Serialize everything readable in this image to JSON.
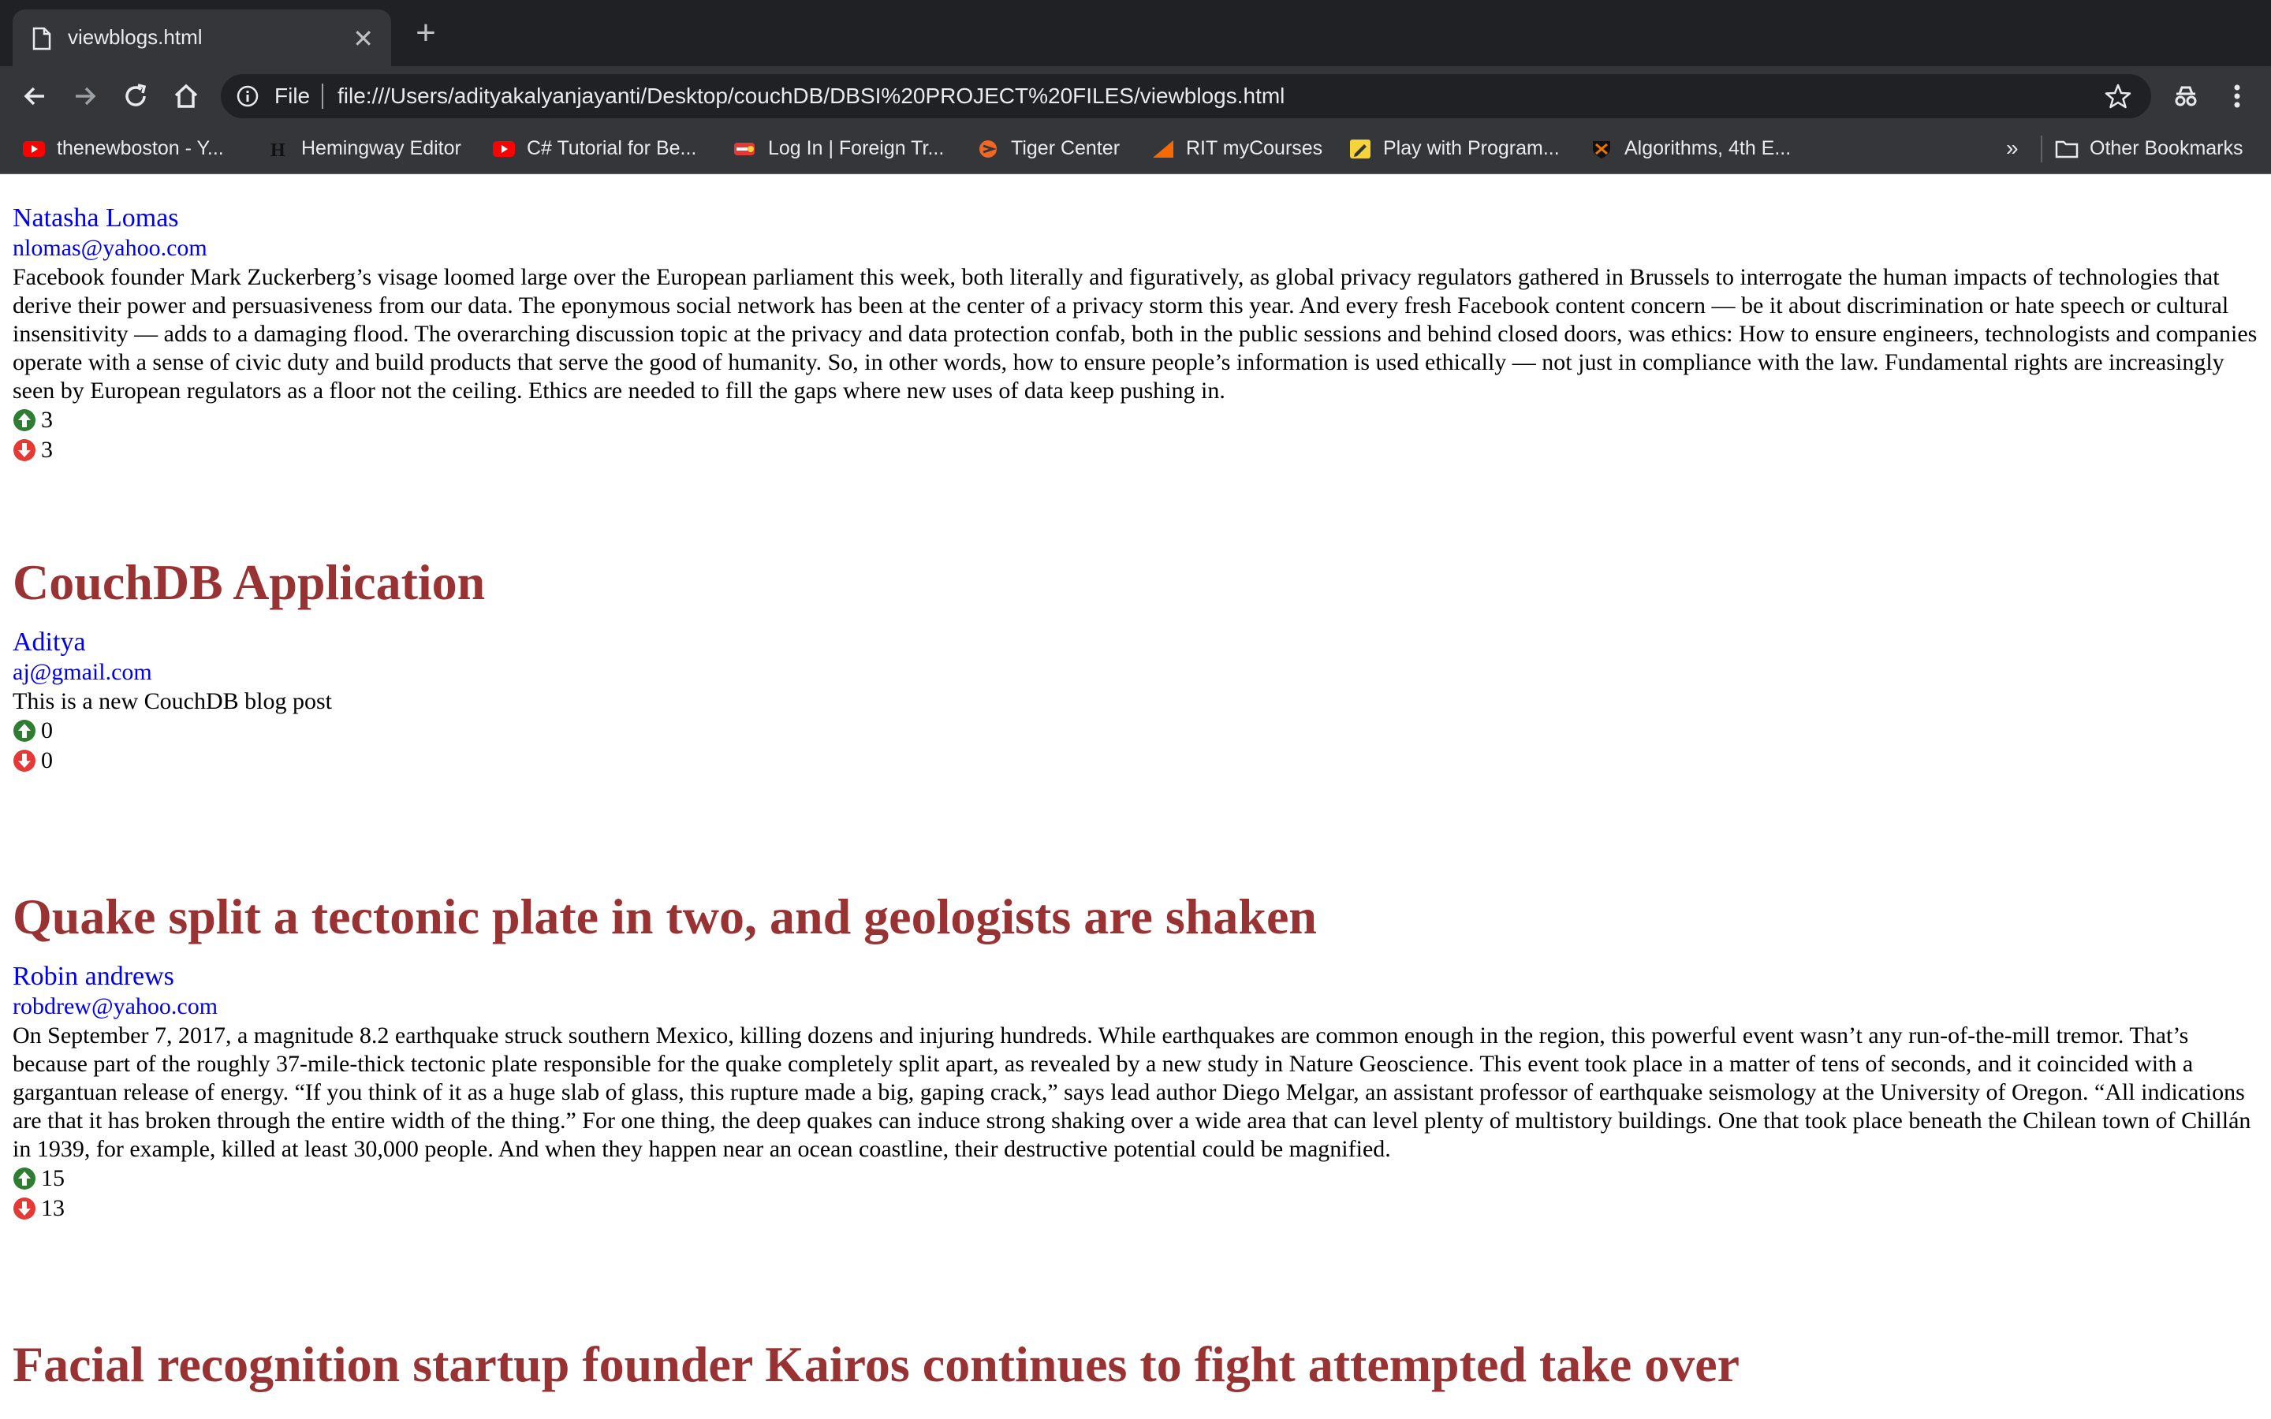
{
  "browser": {
    "tab_title": "viewblogs.html",
    "close_glyph": "✕",
    "new_tab_glyph": "+",
    "url_protocol": "File",
    "url": "file:///Users/adityakalyanjayanti/Desktop/couchDB/DBSI%20PROJECT%20FILES/viewblogs.html",
    "bookmarks": [
      {
        "label": "thenewboston - Y...",
        "icon": "youtube-icon",
        "color": "#ff0000"
      },
      {
        "label": "Hemingway Editor",
        "icon": "hemingway-h-icon",
        "color": "#000000"
      },
      {
        "label": "C# Tutorial for Be...",
        "icon": "youtube-icon",
        "color": "#ff0000"
      },
      {
        "label": "Log In | Foreign Tr...",
        "icon": "foreign-trade-icon",
        "color": "#e53935"
      },
      {
        "label": "Tiger Center",
        "icon": "tiger-center-icon",
        "color": "#f26722"
      },
      {
        "label": "RIT myCourses",
        "icon": "mycourses-icon",
        "color": "#f76902"
      },
      {
        "label": "Play with Program...",
        "icon": "pencil-icon",
        "color": "#f5d33b"
      },
      {
        "label": "Algorithms, 4th E...",
        "icon": "princeton-shield-icon",
        "color": "#e77500"
      }
    ],
    "overflow_glyph": "»",
    "other_bookmarks": "Other Bookmarks"
  },
  "posts": [
    {
      "title": "",
      "author": "Natasha Lomas",
      "email": "nlomas@yahoo.com",
      "body": "Facebook founder Mark Zuckerberg’s visage loomed large over the European parliament this week, both literally and figuratively, as global privacy regulators gathered in Brussels to interrogate the human impacts of technologies that derive their power and persuasiveness from our data. The eponymous social network has been at the center of a privacy storm this year. And every fresh Facebook content concern — be it about discrimination or hate speech or cultural insensitivity — adds to a damaging flood. The overarching discussion topic at the privacy and data protection confab, both in the public sessions and behind closed doors, was ethics: How to ensure engineers, technologists and companies operate with a sense of civic duty and build products that serve the good of humanity. So, in other words, how to ensure people’s information is used ethically — not just in compliance with the law. Fundamental rights are increasingly seen by European regulators as a floor not the ceiling. Ethics are needed to fill the gaps where new uses of data keep pushing in.",
      "upvotes": "3",
      "downvotes": "3"
    },
    {
      "title": "CouchDB Application",
      "author": "Aditya",
      "email": "aj@gmail.com",
      "body": "This is a new CouchDB blog post",
      "upvotes": "0",
      "downvotes": "0"
    },
    {
      "title": "Quake split a tectonic plate in two, and geologists are shaken",
      "author": "Robin andrews",
      "email": "robdrew@yahoo.com",
      "body": "On September 7, 2017, a magnitude 8.2 earthquake struck southern Mexico, killing dozens and injuring hundreds. While earthquakes are common enough in the region, this powerful event wasn’t any run-of-the-mill tremor. That’s because part of the roughly 37-mile-thick tectonic plate responsible for the quake completely split apart, as revealed by a new study in Nature Geoscience. This event took place in a matter of tens of seconds, and it coincided with a gargantuan release of energy. “If you think of it as a huge slab of glass, this rupture made a big, gaping crack,” says lead author Diego Melgar, an assistant professor of earthquake seismology at the University of Oregon. “All indications are that it has broken through the entire width of the thing.” For one thing, the deep quakes can induce strong shaking over a wide area that can level plenty of multistory buildings. One that took place beneath the Chilean town of Chillán in 1939, for example, killed at least 30,000 people. And when they happen near an ocean coastline, their destructive potential could be magnified.",
      "upvotes": "15",
      "downvotes": "13"
    },
    {
      "title": "Facial recognition startup founder Kairos continues to fight attempted take over"
    }
  ],
  "colors": {
    "title": "#993333",
    "link": "#0000ee",
    "upvote": "#2e7d32",
    "downvote": "#e53935"
  }
}
